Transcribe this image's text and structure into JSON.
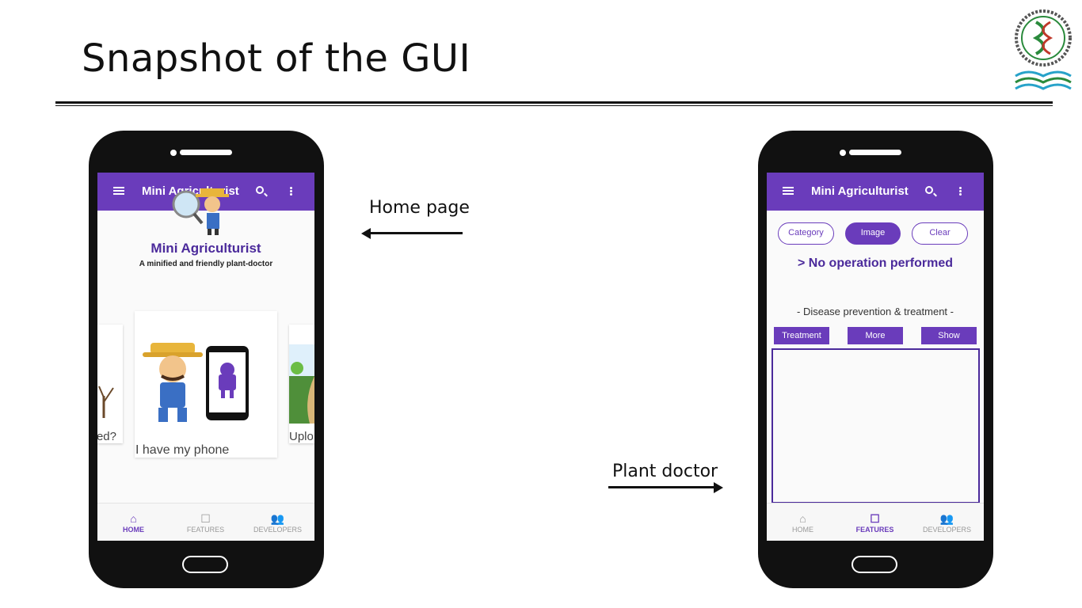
{
  "slide": {
    "title": "Snapshot of the GUI"
  },
  "logo": {
    "text": "HSTU"
  },
  "home_phone": {
    "appbar": {
      "title": "Mini Agriculturist",
      "search_icon": "search-icon",
      "more_icon": "more-vert-icon",
      "menu_icon": "menu-icon"
    },
    "app_name": "Mini Agriculturist",
    "tagline": "A minified and friendly plant-doctor",
    "carousel": {
      "left_caption": "ed?",
      "main_caption": "I have my phone",
      "right_caption": "Uplo"
    },
    "bottom_nav": [
      {
        "label": "HOME",
        "icon": "home-icon",
        "active": true
      },
      {
        "label": "FEATURES",
        "icon": "features-icon",
        "active": false
      },
      {
        "label": "DEVELOPERS",
        "icon": "people-icon",
        "active": false
      }
    ]
  },
  "doctor_phone": {
    "appbar": {
      "title": "Mini Agriculturist"
    },
    "chips": {
      "category": "Category",
      "image": "Image",
      "clear": "Clear"
    },
    "status": "> No operation performed",
    "section_label": "- Disease prevention & treatment -",
    "buttons": {
      "treatment": "Treatment",
      "more": "More",
      "show": "Show"
    },
    "bottom_nav": [
      {
        "label": "HOME",
        "icon": "home-icon",
        "active": false
      },
      {
        "label": "FEATURES",
        "icon": "features-icon",
        "active": true
      },
      {
        "label": "DEVELOPERS",
        "icon": "people-icon",
        "active": false
      }
    ]
  },
  "annotations": {
    "home_label": "Home page",
    "doctor_label": "Plant doctor"
  },
  "colors": {
    "accent": "#6a3cbb",
    "title_purple": "#4b2a9b"
  }
}
